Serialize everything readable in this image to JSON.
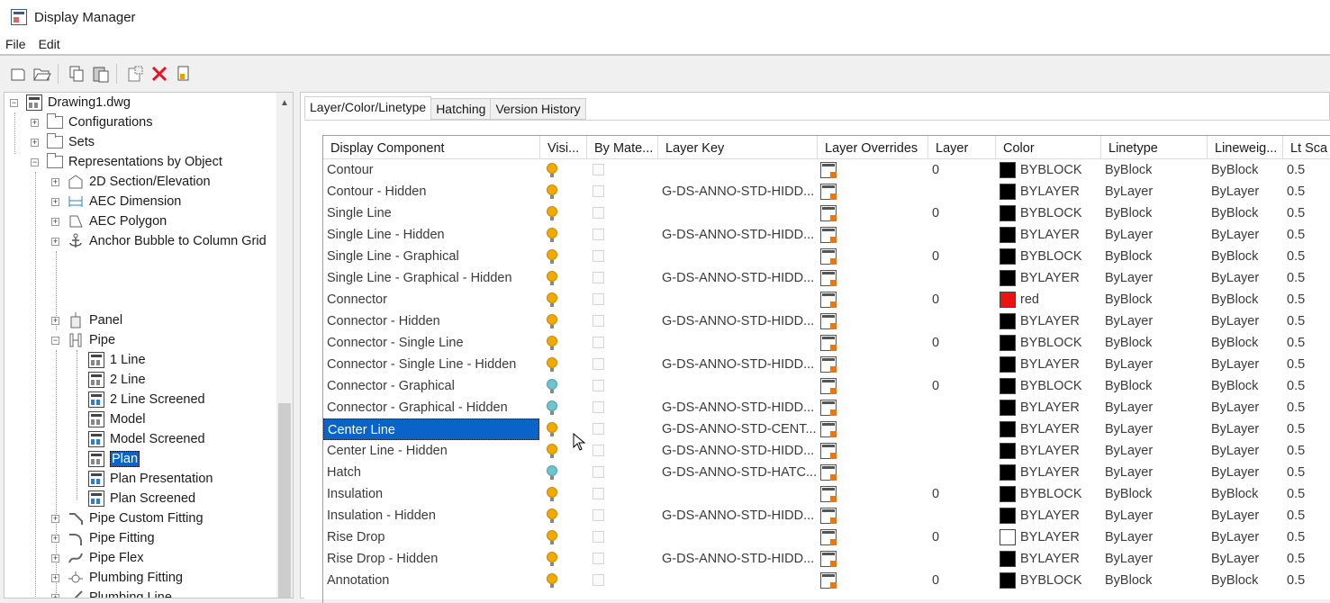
{
  "window": {
    "title": "Display Manager"
  },
  "menu": [
    "File",
    "Edit"
  ],
  "tree": {
    "root": "Drawing1.dwg",
    "items": [
      {
        "label": "Configurations",
        "level": 1,
        "kind": "folder"
      },
      {
        "label": "Sets",
        "level": 1,
        "kind": "folder"
      },
      {
        "label": "Representations by Object",
        "level": 1,
        "kind": "folder"
      },
      {
        "label": "2D Section/Elevation",
        "level": 2,
        "kind": "obj"
      },
      {
        "label": "AEC Dimension",
        "level": 2,
        "kind": "obj"
      },
      {
        "label": "AEC Polygon",
        "level": 2,
        "kind": "obj"
      },
      {
        "label": "Anchor Bubble to Column Grid",
        "level": 2,
        "kind": "obj"
      },
      {
        "label": "Panel",
        "level": 2,
        "kind": "obj"
      },
      {
        "label": "Pipe",
        "level": 2,
        "kind": "obj"
      },
      {
        "label": "1 Line",
        "level": 3,
        "kind": "rep"
      },
      {
        "label": "2 Line",
        "level": 3,
        "kind": "rep"
      },
      {
        "label": "2 Line Screened",
        "level": 3,
        "kind": "rep"
      },
      {
        "label": "Model",
        "level": 3,
        "kind": "rep"
      },
      {
        "label": "Model Screened",
        "level": 3,
        "kind": "rep"
      },
      {
        "label": "Plan",
        "level": 3,
        "kind": "rep"
      },
      {
        "label": "Plan Presentation",
        "level": 3,
        "kind": "rep"
      },
      {
        "label": "Plan Screened",
        "level": 3,
        "kind": "rep"
      },
      {
        "label": "Pipe Custom Fitting",
        "level": 2,
        "kind": "obj"
      },
      {
        "label": "Pipe Fitting",
        "level": 2,
        "kind": "obj"
      },
      {
        "label": "Pipe Flex",
        "level": 2,
        "kind": "obj"
      },
      {
        "label": "Plumbing Fitting",
        "level": 2,
        "kind": "obj"
      },
      {
        "label": "Plumbing Line",
        "level": 2,
        "kind": "obj"
      }
    ]
  },
  "tabs": [
    "Layer/Color/Linetype",
    "Hatching",
    "Version History"
  ],
  "grid": {
    "columns": [
      "Display Component",
      "Visi...",
      "By Mate...",
      "Layer Key",
      "Layer Overrides",
      "Layer",
      "Color",
      "Linetype",
      "Lineweig...",
      "Lt Sca"
    ],
    "rows": [
      {
        "name": "Contour",
        "vis": "on",
        "key": "",
        "layer": "0",
        "color": "BYBLOCK",
        "swatch": "#000000",
        "lt": "ByBlock",
        "lw": "ByBlock",
        "ls": "0.5"
      },
      {
        "name": "Contour - Hidden",
        "vis": "on",
        "key": "G-DS-ANNO-STD-HIDD...",
        "layer": "",
        "color": "BYLAYER",
        "swatch": "#000000",
        "lt": "ByLayer",
        "lw": "ByLayer",
        "ls": "0.5"
      },
      {
        "name": "Single Line",
        "vis": "on",
        "key": "",
        "layer": "0",
        "color": "BYBLOCK",
        "swatch": "#000000",
        "lt": "ByBlock",
        "lw": "ByBlock",
        "ls": "0.5"
      },
      {
        "name": "Single Line - Hidden",
        "vis": "on",
        "key": "G-DS-ANNO-STD-HIDD...",
        "layer": "",
        "color": "BYLAYER",
        "swatch": "#000000",
        "lt": "ByLayer",
        "lw": "ByLayer",
        "ls": "0.5"
      },
      {
        "name": "Single Line - Graphical",
        "vis": "on",
        "key": "",
        "layer": "0",
        "color": "BYBLOCK",
        "swatch": "#000000",
        "lt": "ByBlock",
        "lw": "ByBlock",
        "ls": "0.5"
      },
      {
        "name": "Single Line - Graphical - Hidden",
        "vis": "on",
        "key": "G-DS-ANNO-STD-HIDD...",
        "layer": "",
        "color": "BYLAYER",
        "swatch": "#000000",
        "lt": "ByLayer",
        "lw": "ByLayer",
        "ls": "0.5"
      },
      {
        "name": "Connector",
        "vis": "on",
        "key": "",
        "layer": "0",
        "color": "red",
        "swatch": "#ee1111",
        "lt": "ByBlock",
        "lw": "ByBlock",
        "ls": "0.5"
      },
      {
        "name": "Connector - Hidden",
        "vis": "on",
        "key": "G-DS-ANNO-STD-HIDD...",
        "layer": "",
        "color": "BYLAYER",
        "swatch": "#000000",
        "lt": "ByLayer",
        "lw": "ByLayer",
        "ls": "0.5"
      },
      {
        "name": "Connector - Single Line",
        "vis": "on",
        "key": "",
        "layer": "0",
        "color": "BYBLOCK",
        "swatch": "#000000",
        "lt": "ByBlock",
        "lw": "ByBlock",
        "ls": "0.5"
      },
      {
        "name": "Connector - Single Line - Hidden",
        "vis": "on",
        "key": "G-DS-ANNO-STD-HIDD...",
        "layer": "",
        "color": "BYLAYER",
        "swatch": "#000000",
        "lt": "ByLayer",
        "lw": "ByLayer",
        "ls": "0.5"
      },
      {
        "name": "Connector - Graphical",
        "vis": "off",
        "key": "",
        "layer": "0",
        "color": "BYBLOCK",
        "swatch": "#000000",
        "lt": "ByBlock",
        "lw": "ByBlock",
        "ls": "0.5"
      },
      {
        "name": "Connector - Graphical - Hidden",
        "vis": "off",
        "key": "G-DS-ANNO-STD-HIDD...",
        "layer": "",
        "color": "BYLAYER",
        "swatch": "#000000",
        "lt": "ByLayer",
        "lw": "ByLayer",
        "ls": "0.5"
      },
      {
        "name": "Center Line",
        "vis": "on",
        "key": "G-DS-ANNO-STD-CENT...",
        "layer": "",
        "color": "BYLAYER",
        "swatch": "#000000",
        "lt": "ByLayer",
        "lw": "ByLayer",
        "ls": "0.5",
        "selected": true
      },
      {
        "name": "Center Line - Hidden",
        "vis": "on",
        "key": "G-DS-ANNO-STD-HIDD...",
        "layer": "",
        "color": "BYLAYER",
        "swatch": "#000000",
        "lt": "ByLayer",
        "lw": "ByLayer",
        "ls": "0.5"
      },
      {
        "name": "Hatch",
        "vis": "off",
        "key": "G-DS-ANNO-STD-HATC...",
        "layer": "",
        "color": "BYLAYER",
        "swatch": "#000000",
        "lt": "ByLayer",
        "lw": "ByLayer",
        "ls": "0.5"
      },
      {
        "name": "Insulation",
        "vis": "on",
        "key": "",
        "layer": "0",
        "color": "BYBLOCK",
        "swatch": "#000000",
        "lt": "ByBlock",
        "lw": "ByBlock",
        "ls": "0.5"
      },
      {
        "name": "Insulation - Hidden",
        "vis": "on",
        "key": "G-DS-ANNO-STD-HIDD...",
        "layer": "",
        "color": "BYLAYER",
        "swatch": "#000000",
        "lt": "ByLayer",
        "lw": "ByLayer",
        "ls": "0.5"
      },
      {
        "name": "Rise Drop",
        "vis": "on",
        "key": "",
        "layer": "0",
        "color": "BYLAYER",
        "swatch": "#ffffff",
        "lt": "ByLayer",
        "lw": "ByLayer",
        "ls": "0.5"
      },
      {
        "name": "Rise Drop - Hidden",
        "vis": "on",
        "key": "G-DS-ANNO-STD-HIDD...",
        "layer": "",
        "color": "BYLAYER",
        "swatch": "#000000",
        "lt": "ByLayer",
        "lw": "ByLayer",
        "ls": "0.5"
      },
      {
        "name": "Annotation",
        "vis": "on",
        "key": "",
        "layer": "0",
        "color": "BYBLOCK",
        "swatch": "#000000",
        "lt": "ByBlock",
        "lw": "ByBlock",
        "ls": "0.5"
      }
    ]
  }
}
